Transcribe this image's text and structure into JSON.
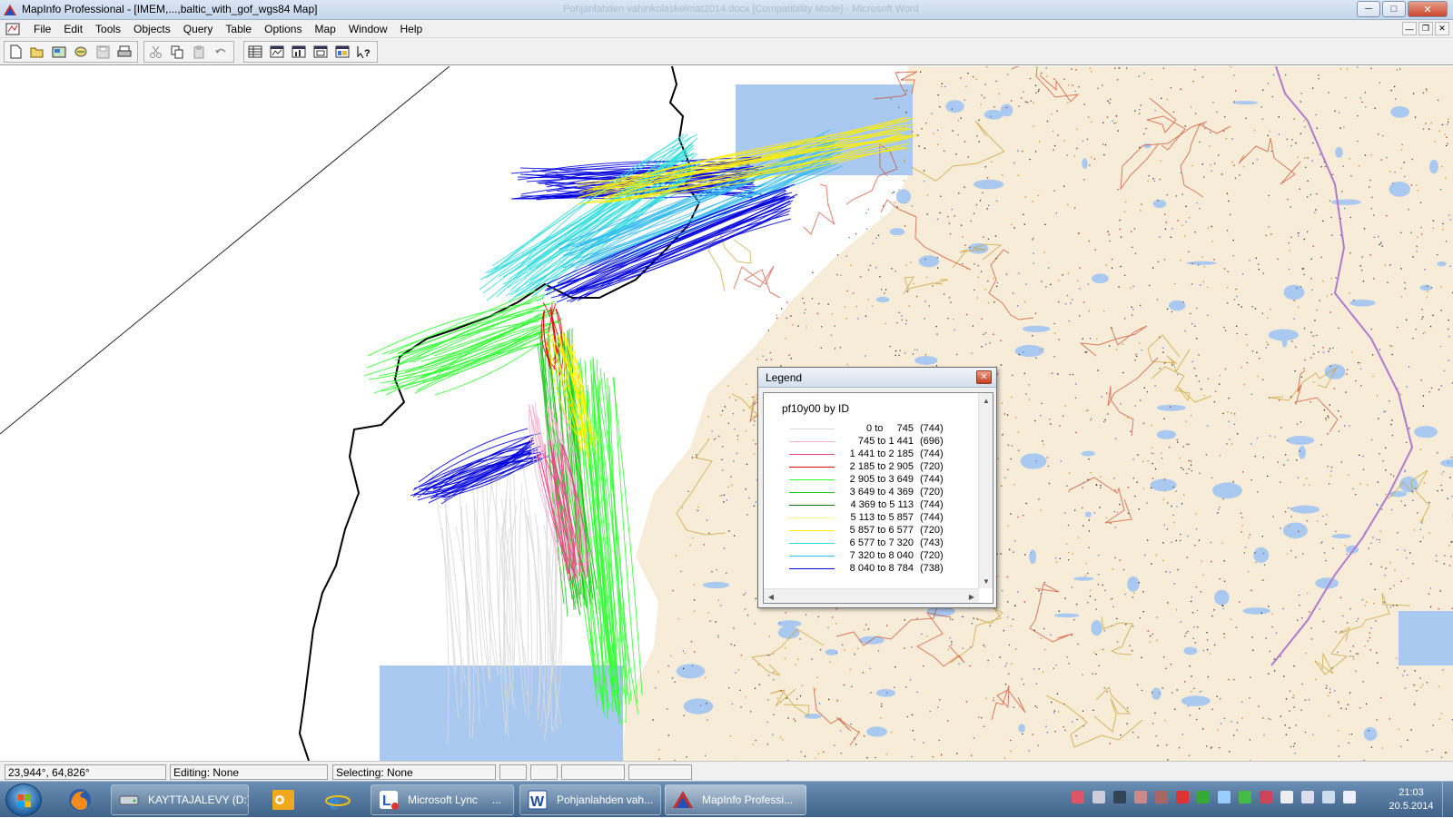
{
  "window": {
    "title": "MapInfo Professional - [IMEM,...,baltic_with_gof_wgs84 Map]",
    "background_title": "Pohjanlahden vahinkolaskelmat2014.docx [Compatibility Mode] - Microsoft Word",
    "caption_buttons": [
      "minimize",
      "maximize",
      "close"
    ]
  },
  "menubar": {
    "items": [
      "File",
      "Edit",
      "Tools",
      "Objects",
      "Query",
      "Table",
      "Options",
      "Map",
      "Window",
      "Help"
    ]
  },
  "toolbar": {
    "groups": [
      [
        "new-icon",
        "open-icon",
        "open-workspace-icon",
        "open-dbms-icon",
        "save-icon",
        "print-icon"
      ],
      [
        "cut-icon",
        "copy-icon",
        "paste-icon",
        "undo-icon"
      ],
      [
        "new-browser-icon",
        "new-mapper-icon",
        "new-grapher-icon",
        "new-layout-icon",
        "new-redistrict-icon",
        "help-icon"
      ]
    ]
  },
  "legend": {
    "title": "Legend",
    "heading": "pf10y00 by ID",
    "rows": [
      {
        "range": "0 to     745",
        "count": "(744)",
        "color": "#d9d9d9"
      },
      {
        "range": "745 to 1 441",
        "count": "(696)",
        "color": "#f7b3d0"
      },
      {
        "range": "1 441 to 2 185",
        "count": "(744)",
        "color": "#e0457f"
      },
      {
        "range": "2 185 to 2 905",
        "count": "(720)",
        "color": "#e00000"
      },
      {
        "range": "2 905 to 3 649",
        "count": "(744)",
        "color": "#33ff33"
      },
      {
        "range": "3 649 to 4 369",
        "count": "(720)",
        "color": "#22c622"
      },
      {
        "range": "4 369 to 5 113",
        "count": "(744)",
        "color": "#0a7a0a"
      },
      {
        "range": "5 113 to 5 857",
        "count": "(744)",
        "color": "#ffff88"
      },
      {
        "range": "5 857 to 6 577",
        "count": "(720)",
        "color": "#ffee00"
      },
      {
        "range": "6 577 to 7 320",
        "count": "(743)",
        "color": "#33dddd"
      },
      {
        "range": "7 320 to 8 040",
        "count": "(720)",
        "color": "#33bbee"
      },
      {
        "range": "8 040 to 8 784",
        "count": "(738)",
        "color": "#0000dd"
      }
    ]
  },
  "statusbar": {
    "coordinates": "23,944°, 64,826°",
    "editing": "Editing: None",
    "selecting": "Selecting: None"
  },
  "taskbar": {
    "tasks": [
      {
        "label": "KAYTTAJALEVY (D:)",
        "icon": "drive-icon"
      },
      {
        "label": "Microsoft Lync",
        "icon": "lync-icon",
        "extra": "..."
      },
      {
        "label": "Pohjanlahden vah...",
        "icon": "word-icon"
      },
      {
        "label": "MapInfo Professi...",
        "icon": "mapinfo-icon",
        "active": true
      }
    ],
    "pinned": [
      "firefox-icon",
      "outlook-icon",
      "internet-explorer-icon"
    ],
    "clock_time": "21:03",
    "clock_date": "20.5.2014"
  }
}
